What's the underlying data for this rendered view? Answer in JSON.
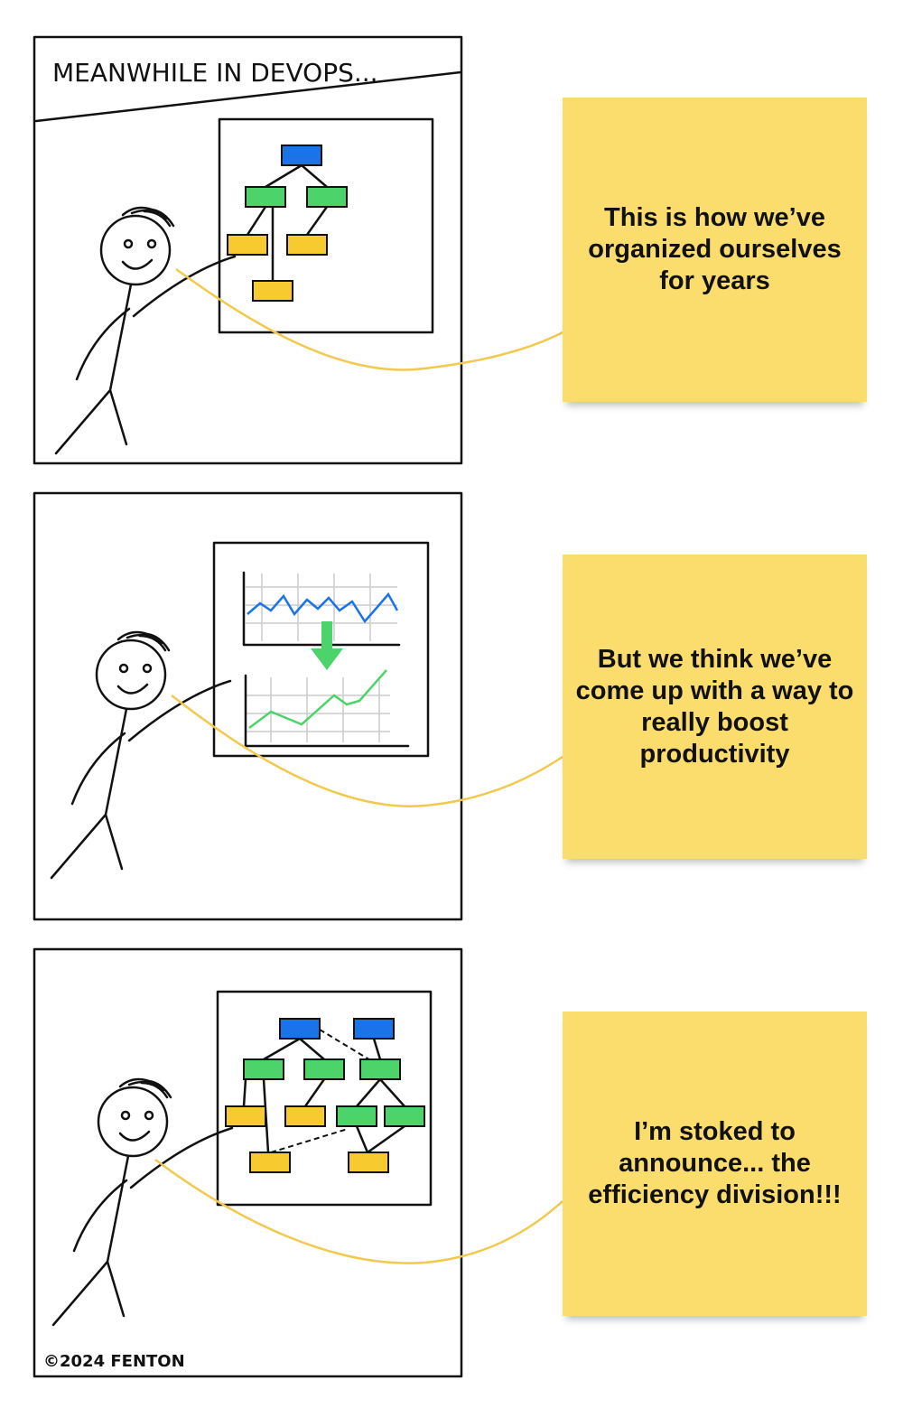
{
  "comic": {
    "title": "MEANWHILE IN DEVOPS...",
    "copyright": "©2024 FENTON",
    "panels": [
      {
        "caption": "This is how we’ve organized ourselves for years",
        "board": "org-chart"
      },
      {
        "caption": "But we think we’ve come up with a way to really boost productivity",
        "board": "productivity-charts"
      },
      {
        "caption": "I’m stoked to announce... the efficiency division!!!",
        "board": "expanded-org-chart"
      }
    ]
  },
  "colors": {
    "note": "#FBDD6E",
    "blue": "#1A73E8",
    "green": "#4CD36A",
    "yellow": "#F7CB2F",
    "connector": "#F2C94C"
  }
}
